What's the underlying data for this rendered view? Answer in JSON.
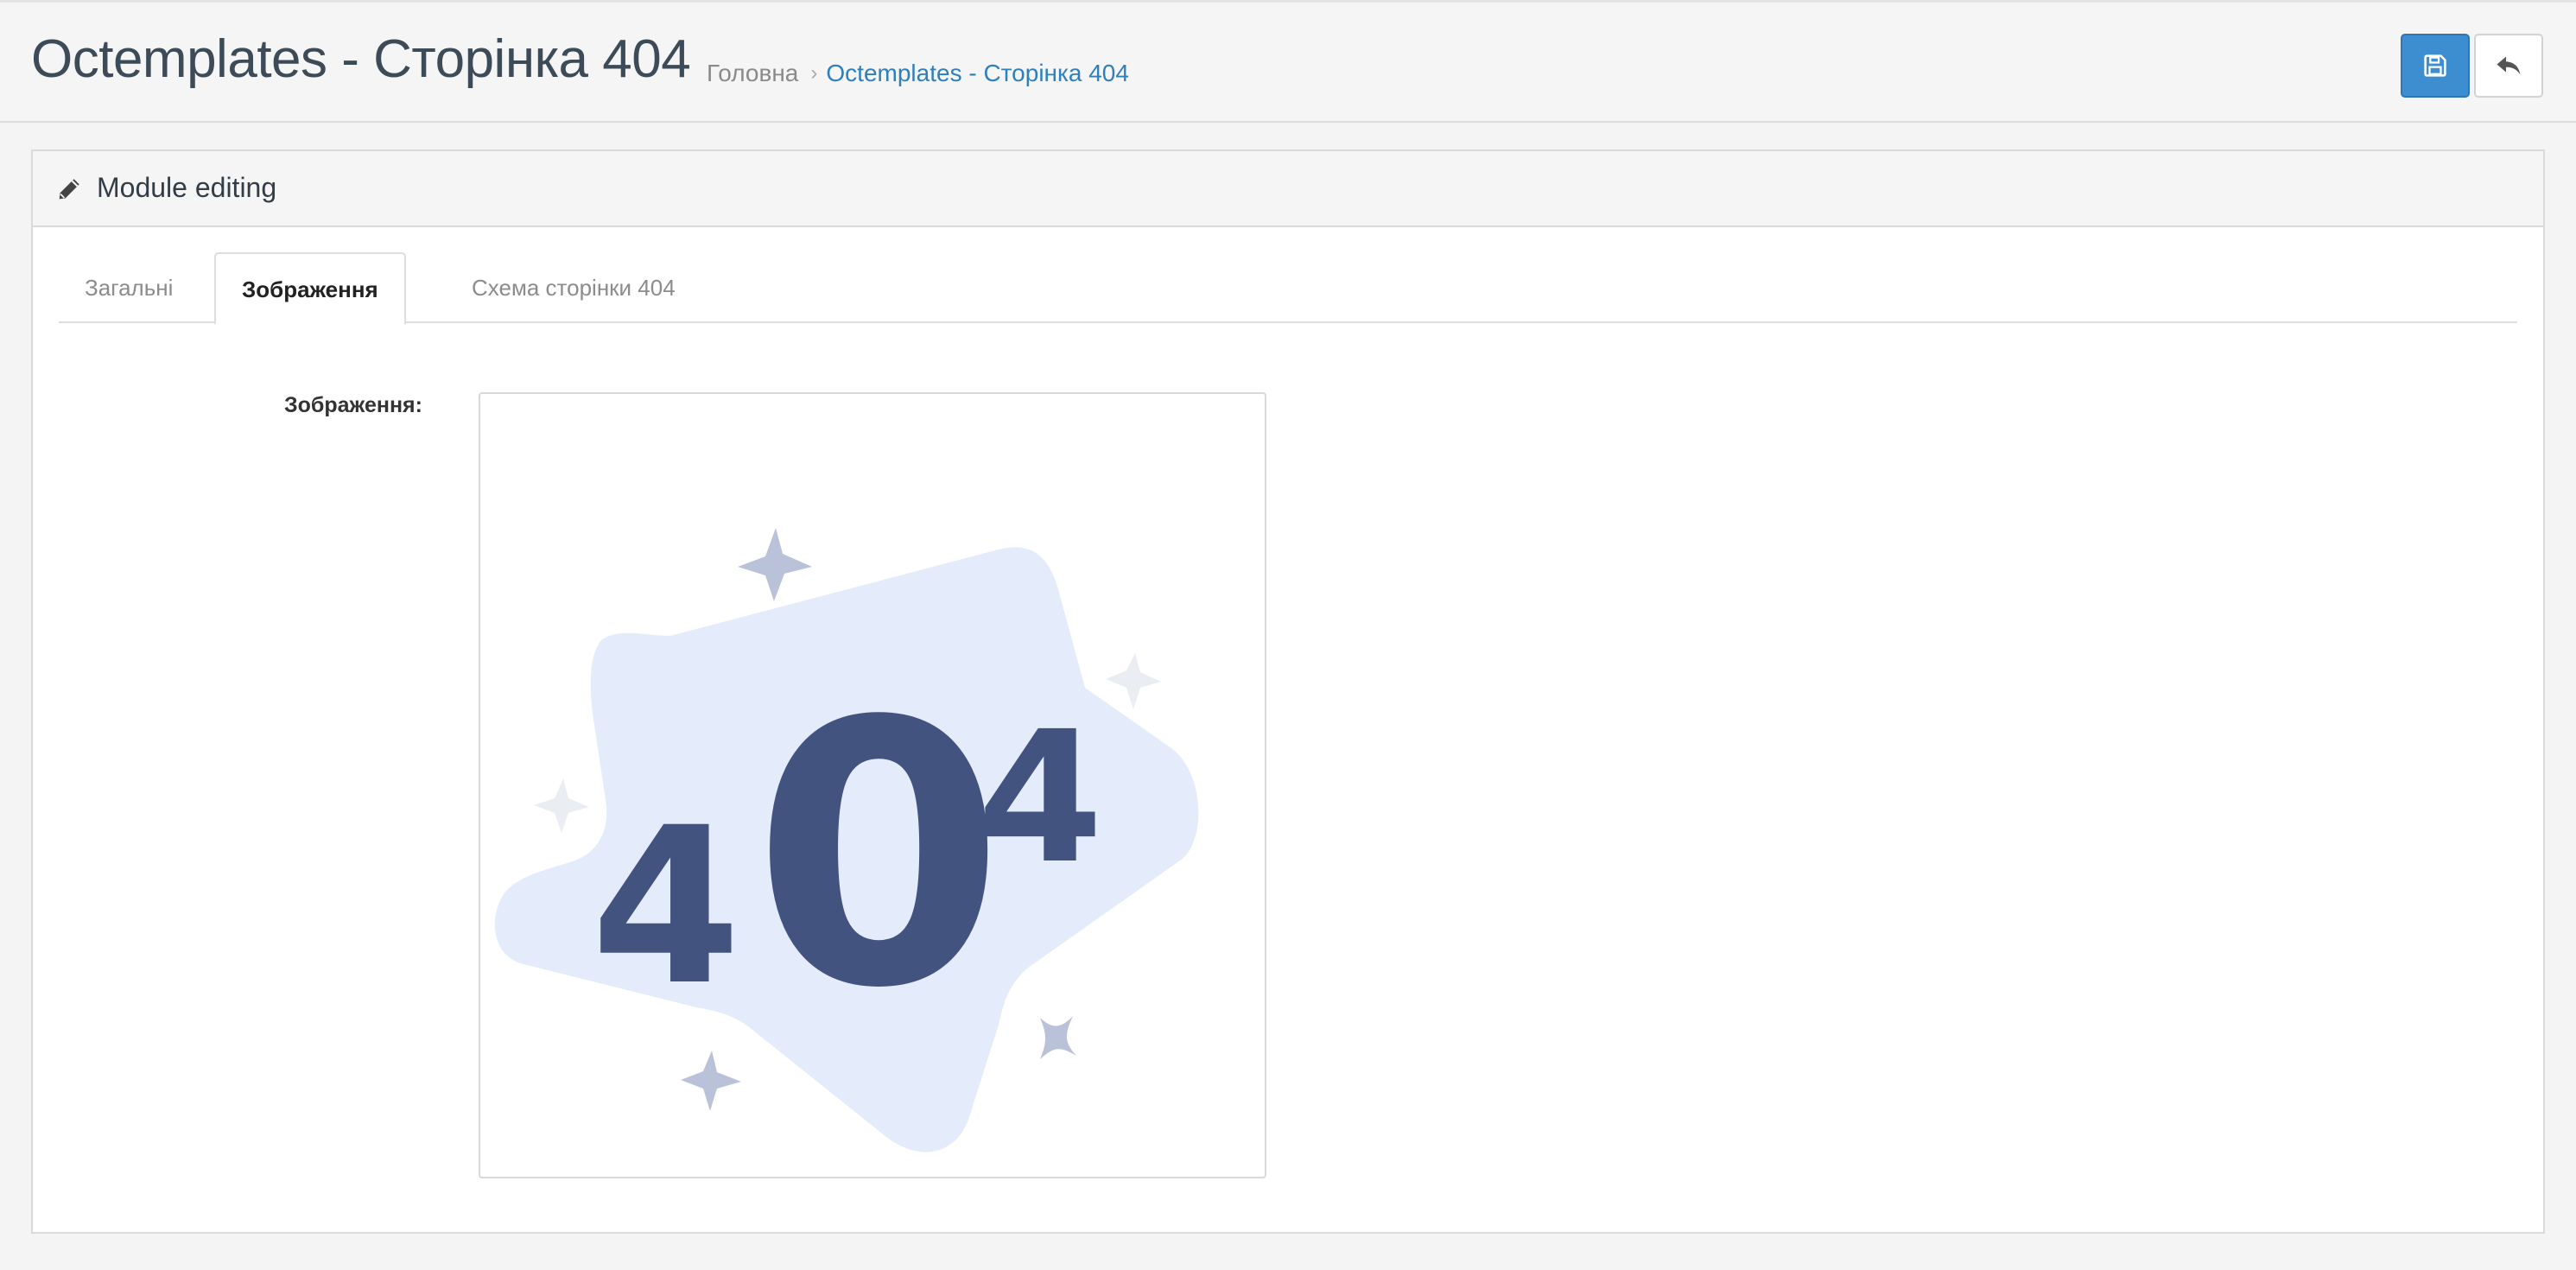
{
  "header": {
    "title": "Octemplates - Сторінка 404",
    "breadcrumb": [
      {
        "label": "Головна"
      },
      {
        "label": "Octemplates - Сторінка 404"
      }
    ],
    "breadcrumb_separator": "›",
    "save_icon": "floppy-disk-icon",
    "back_icon": "reply-arrow-icon"
  },
  "panel": {
    "title": "Module editing",
    "title_icon": "pencil-icon",
    "tabs": [
      {
        "label": "Загальні",
        "active": false
      },
      {
        "label": "Зображення",
        "active": true
      },
      {
        "label": "Схема сторінки 404",
        "active": false
      }
    ]
  },
  "form": {
    "image_label": "Зображення:",
    "image_text": "404"
  },
  "colors": {
    "primary": "#3d8ed1",
    "link": "#2f7fba",
    "illustration_digits": "#435380",
    "illustration_blob": "#e4ebfa"
  }
}
